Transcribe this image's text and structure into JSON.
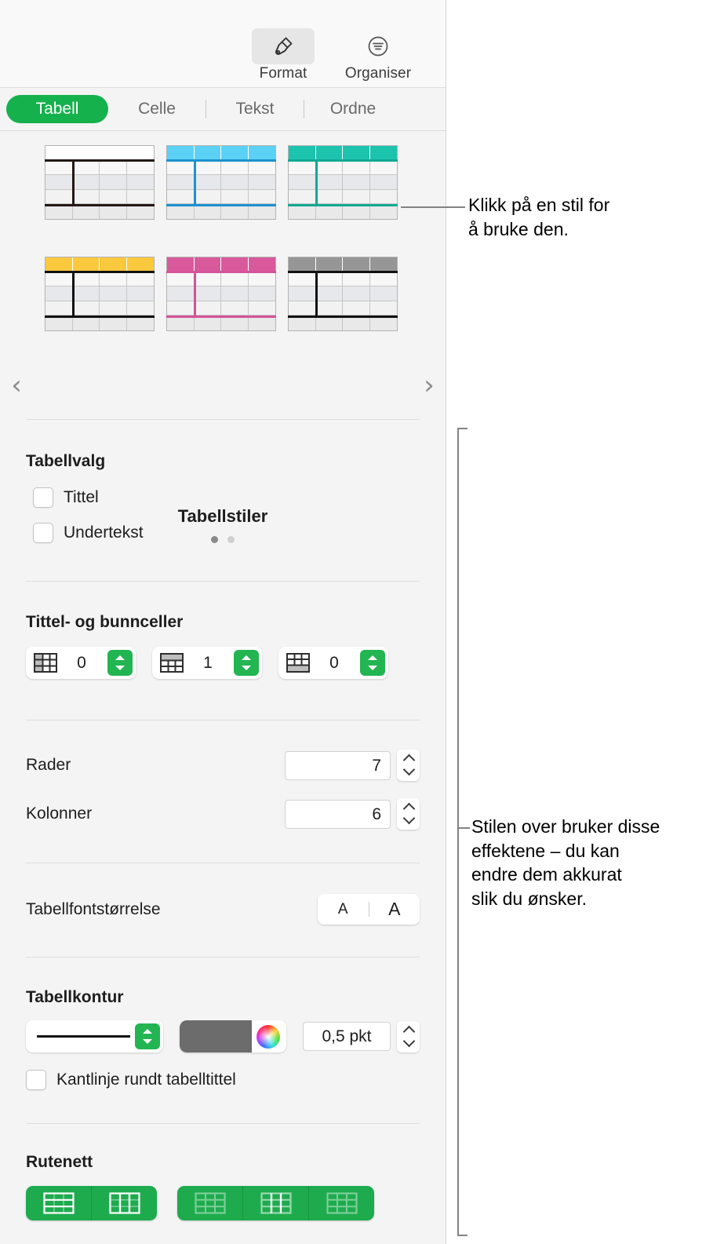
{
  "app": {
    "panel_title": "Format inspector",
    "accent_green": "#14b14d",
    "stepper_green": "#22b552",
    "grid_button_green": "#1eab4e"
  },
  "toolbar": {
    "buttons": [
      {
        "label": "Format",
        "icon": "paintbrush-icon",
        "active": true
      },
      {
        "label": "Organiser",
        "icon": "organize-icon",
        "active": false
      }
    ]
  },
  "tabs": {
    "items": [
      {
        "label": "Tabell",
        "selected": true
      },
      {
        "label": "Celle",
        "selected": false
      },
      {
        "label": "Tekst",
        "selected": false
      },
      {
        "label": "Ordne",
        "selected": false
      }
    ]
  },
  "gallery": {
    "caption": "Tabellstiler",
    "prev_icon": "chevron-left-icon",
    "next_icon": "chevron-right-icon",
    "page_dots": {
      "count": 2,
      "active_index": 0
    },
    "styles": [
      {
        "name": "Basic",
        "header_color": "#ffffff",
        "accent_color": "#231815",
        "header_border": "#b9b9b9"
      },
      {
        "name": "Cyan",
        "header_color": "#5bd1f5",
        "accent_color": "#1e92d0",
        "header_border": "#5bd1f5"
      },
      {
        "name": "Teal",
        "header_color": "#1cc4ae",
        "accent_color": "#12a893",
        "header_border": "#1cc4ae"
      },
      {
        "name": "Yellow",
        "header_color": "#fbc93d",
        "accent_color": "#111111",
        "header_border": "#fbc93d"
      },
      {
        "name": "Pink",
        "header_color": "#d85a9c",
        "accent_color": "#d4539a",
        "header_border": "#d85a9c"
      },
      {
        "name": "Gray",
        "header_color": "#969696",
        "accent_color": "#111111",
        "header_border": "#969696"
      }
    ]
  },
  "table_options": {
    "title": "Tabellvalg",
    "checkboxes": [
      {
        "label": "Tittel",
        "checked": false
      },
      {
        "label": "Undertekst",
        "checked": false
      }
    ]
  },
  "header_footer": {
    "title": "Tittel- og bunnceller",
    "steppers": [
      {
        "icon": "header-columns-icon",
        "value": "0"
      },
      {
        "icon": "header-rows-icon",
        "value": "1"
      },
      {
        "icon": "footer-rows-icon",
        "value": "0"
      }
    ]
  },
  "dimensions": {
    "rows": {
      "label": "Rader",
      "value": "7"
    },
    "columns": {
      "label": "Kolonner",
      "value": "6"
    }
  },
  "font_size": {
    "label": "Tabellfontstørrelse",
    "decrease": "A",
    "increase": "A"
  },
  "table_border": {
    "title": "Tabellkontur",
    "line_style": "solid-line",
    "color": "#6c6c6c",
    "width_value": "0,5 pkt",
    "checkbox": {
      "label": "Kantlinje rundt tabelltittel",
      "checked": false
    }
  },
  "grid_lines": {
    "title": "Rutenett",
    "group_a": [
      {
        "icon": "grid-horizontal-icon",
        "enabled": true
      },
      {
        "icon": "grid-vertical-icon",
        "enabled": true
      }
    ],
    "group_b": [
      {
        "icon": "grid-outer-horizontal-icon",
        "enabled": false
      },
      {
        "icon": "grid-inner-vertical-icon",
        "enabled": true
      },
      {
        "icon": "grid-outer-icon",
        "enabled": false
      }
    ]
  },
  "callouts": [
    {
      "id": "styles",
      "line1": "Klikk på en stil for",
      "line2": "å bruke den."
    },
    {
      "id": "effects",
      "line1": "Stilen over bruker disse",
      "line2": "effektene – du kan",
      "line3": "endre dem akkurat",
      "line4": "slik du ønsker."
    }
  ]
}
